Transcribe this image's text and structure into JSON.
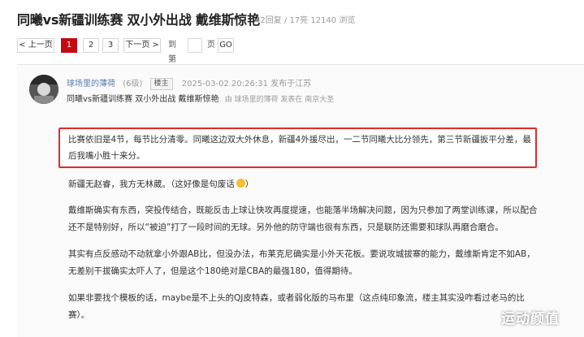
{
  "thread": {
    "title": "同曦vs新疆训练赛 双小外出战 戴维斯惊艳",
    "stats": "42回复 / 17亮 12140 浏览"
  },
  "pagination": {
    "prev_label": "< 上一页",
    "pages": [
      "1",
      "2",
      "3"
    ],
    "active_page": "1",
    "next_label": "下一页 >",
    "goto_label": "到第",
    "page_unit": "页",
    "go_label": "GO"
  },
  "post": {
    "author": "球场里的薄荷",
    "level": "(6级)",
    "badge": "楼主",
    "datetime": "2025-03-02 20:26:31 发布于江苏",
    "subtitle": "同曦vs新疆训练赛 双小外出战 戴维斯惊艳",
    "subtitle_meta": "由 球场里的薄荷 发表在 南京大圣",
    "highlight": "比赛依旧是4节，每节比分清零。同曦这边双大外休息，新疆4外援尽出，一二节同曦大比分领先，第三节新疆扳平分差，最后我嘴小胜十来分。",
    "paragraphs": [
      "新疆无赵睿，我方无林葳。（这好像是句废话",
      "戴维斯确实有东西，突投传结合，既能反击上球让快攻再度提速，也能落半场解决问题，因为只参加了两堂训练课，所以配合还不是特别好，所以“被迫”打了一段时间的无球。另外他的防守端也很有东西，只是联防还需要和球队再磨合磨合。",
      "其实有点反感动不动就拿小外跟AB比，但没办法，布莱克尼确实是小外天花板。要说攻城拔寨的能力，戴维斯肯定不如AB，无差别干拔确实太吓人了，但是这个180绝对是CBA的最强180，值得期待。",
      "如果非要找个模板的话，maybe是不上头的QJ皮特森，或者弱化版的马布里（这点纯印象流，楼主其实没咋看过老马的比赛）。"
    ],
    "emoji_suffix": "）"
  },
  "watermark": "运动颜值"
}
